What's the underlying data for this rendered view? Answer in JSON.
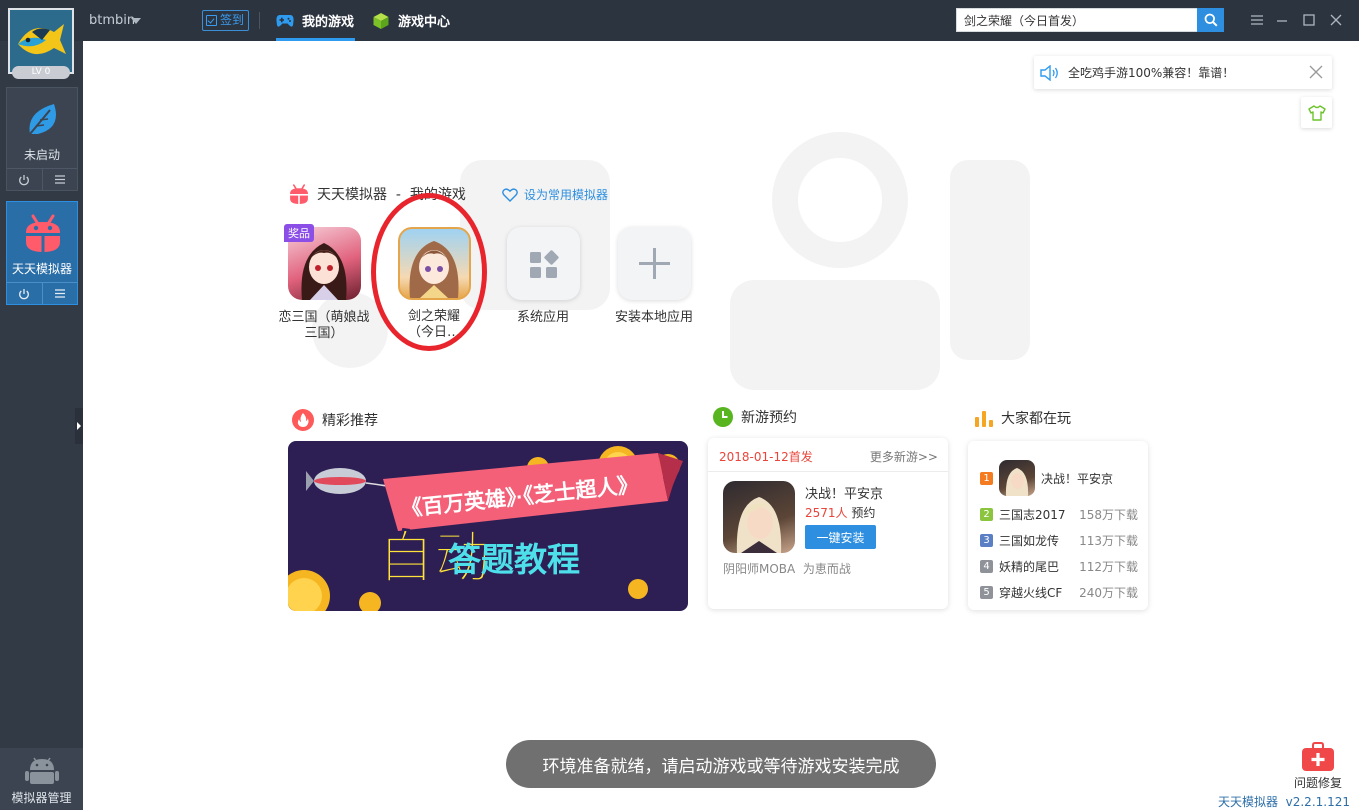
{
  "topbar": {
    "username": "btmbin",
    "level": "LV 0",
    "checkin_label": "签到",
    "tabs": [
      {
        "label": "我的游戏",
        "active": true
      },
      {
        "label": "游戏中心",
        "active": false
      }
    ],
    "search": {
      "value": "剑之荣耀（今日首发）",
      "placeholder": ""
    }
  },
  "sidebar": {
    "instances": [
      {
        "name": "未启动",
        "active": false
      },
      {
        "name": "天天模拟器",
        "active": true
      }
    ],
    "manager_label": "模拟器管理"
  },
  "notice": {
    "text": "全吃鸡手游100%兼容！靠谱！"
  },
  "my_games": {
    "title": "天天模拟器  -  我的游戏",
    "favorite_link": "设为常用模拟器",
    "prize_tag": "奖品",
    "items": [
      {
        "label": "恋三国（萌娘战三国）"
      },
      {
        "label": "剑之荣耀（今日…"
      },
      {
        "label": "系统应用"
      },
      {
        "label": "安装本地应用"
      }
    ]
  },
  "recommend": {
    "title": "精彩推荐",
    "banner_top": "《百万英雄》·《芝士超人》",
    "banner_big": "自动",
    "banner_sub": "答题教程"
  },
  "preorder": {
    "title": "新游预约",
    "date": "2018-01-12首发",
    "more": "更多新游>>",
    "game_name": "决战！平安京",
    "count": "2571人",
    "count_suffix": "预约",
    "button": "一键安装",
    "desc": "阴阳师MOBA  为恵而战"
  },
  "popular": {
    "title": "大家都在玩",
    "items": [
      {
        "rank": "1",
        "name": "决战！平安京",
        "downloads": ""
      },
      {
        "rank": "2",
        "name": "三国志2017",
        "downloads": "158万下载"
      },
      {
        "rank": "3",
        "name": "三国如龙传",
        "downloads": "113万下载"
      },
      {
        "rank": "4",
        "name": "妖精的尾巴",
        "downloads": "112万下载"
      },
      {
        "rank": "5",
        "name": "穿越火线CF",
        "downloads": "240万下载"
      }
    ],
    "rank_colors": [
      "#f47b20",
      "#8bc43f",
      "#5b7fc4",
      "#8f9399",
      "#8f9399"
    ]
  },
  "toast": "环境准备就绪，请启动游戏或等待游戏安装完成",
  "repair_label": "问题修复",
  "version": "天天模拟器  v2.2.1.121",
  "colors": {
    "accent": "#2e8fe0",
    "topbar": "#2c3440",
    "sidebar": "#323a45",
    "alert": "#e8242c"
  }
}
